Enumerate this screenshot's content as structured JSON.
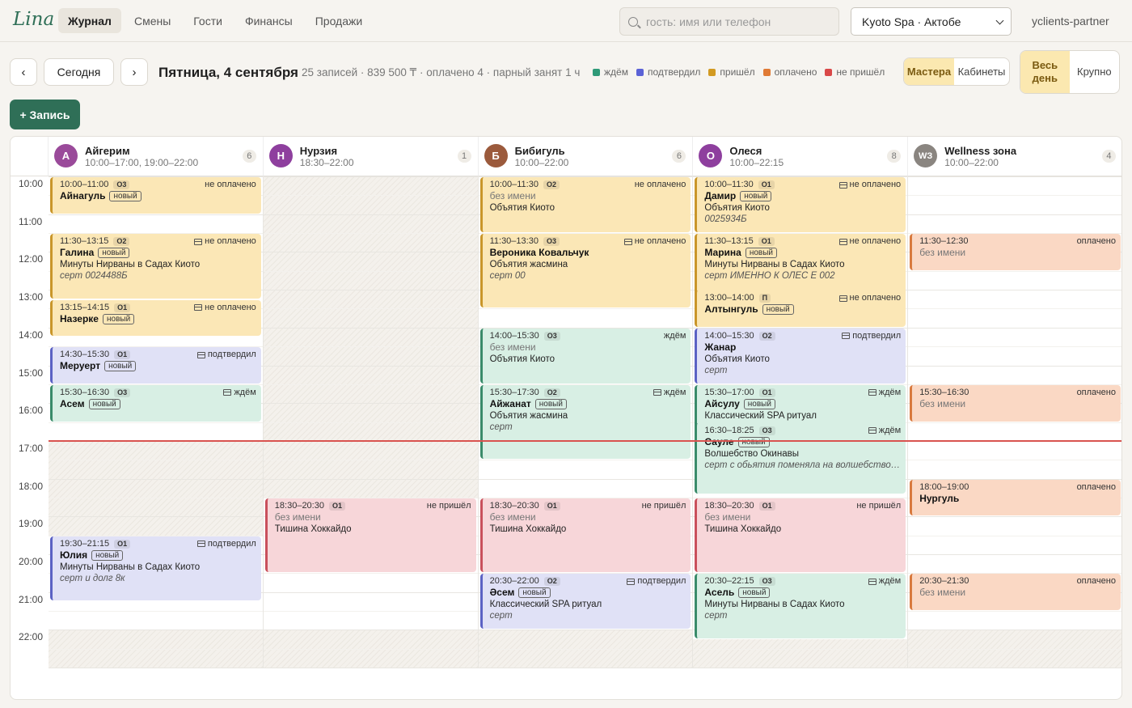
{
  "app": {
    "logo": "Lina",
    "user": "yclients-partner"
  },
  "nav": [
    "Журнал",
    "Смены",
    "Гости",
    "Финансы",
    "Продажи"
  ],
  "search": {
    "placeholder": "гость: имя или телефон"
  },
  "branch": "Kyoto Spa · Актобе",
  "toolbar": {
    "today": "Сегодня",
    "date": "Пятница, 4 сентября",
    "summary": "25 записей · 839 500 ₸ · оплачено 4 · парный занят 1 ч",
    "view_masters": "Мастера",
    "view_rooms": "Кабинеты",
    "range_day": "Весь день",
    "range_big": "Крупно",
    "add": "+ Запись"
  },
  "legend": [
    {
      "label": "ждём",
      "color": "#2f9a78"
    },
    {
      "label": "подтвердил",
      "color": "#5b62d6"
    },
    {
      "label": "пришёл",
      "color": "#d29a22"
    },
    {
      "label": "оплачено",
      "color": "#e07a35"
    },
    {
      "label": "не пришёл",
      "color": "#d94848"
    }
  ],
  "hours": [
    "10:00",
    "11:00",
    "12:00",
    "13:00",
    "14:00",
    "15:00",
    "16:00",
    "17:00",
    "18:00",
    "19:00",
    "20:00",
    "21:00",
    "22:00"
  ],
  "masters": [
    {
      "initial": "А",
      "name": "Айгерим",
      "hours": "10:00–17:00, 19:00–22:00",
      "count": "6",
      "color": "#9a4a9a"
    },
    {
      "initial": "Н",
      "name": "Нурзия",
      "hours": "18:30–22:00",
      "count": "1",
      "color": "#8e3f9e"
    },
    {
      "initial": "Б",
      "name": "Бибигуль",
      "hours": "10:00–22:00",
      "count": "6",
      "color": "#9b5a3c"
    },
    {
      "initial": "О",
      "name": "Олеся",
      "hours": "10:00–22:15",
      "count": "8",
      "color": "#8e3f9e"
    },
    {
      "initial": "WЗ",
      "name": "Wellness зона",
      "hours": "10:00–22:00",
      "count": "4",
      "color": "#8a8580"
    }
  ],
  "appointments": [
    {
      "col": 0,
      "start": "10:00",
      "end": "11:00",
      "time": "10:00–11:00",
      "room": "О3",
      "status": "не оплачено",
      "reg": false,
      "name": "Айнагуль",
      "new": true,
      "service": "",
      "note": "",
      "color": "y"
    },
    {
      "col": 0,
      "start": "11:30",
      "end": "13:15",
      "time": "11:30–13:15",
      "room": "О2",
      "status": "не оплачено",
      "reg": true,
      "name": "Галина",
      "new": true,
      "service": "Минуты Нирваны в Садах Киото",
      "note": "серт 0024488Б",
      "color": "y"
    },
    {
      "col": 0,
      "start": "13:15",
      "end": "14:15",
      "time": "13:15–14:15",
      "room": "О1",
      "status": "не оплачено",
      "reg": true,
      "name": "Назерке",
      "new": true,
      "service": "",
      "note": "",
      "color": "y"
    },
    {
      "col": 0,
      "start": "14:30",
      "end": "15:30",
      "time": "14:30–15:30",
      "room": "О1",
      "status": "подтвердил",
      "reg": true,
      "name": "Меруерт",
      "new": true,
      "service": "",
      "note": "",
      "color": "b"
    },
    {
      "col": 0,
      "start": "15:30",
      "end": "16:30",
      "time": "15:30–16:30",
      "room": "О3",
      "status": "ждём",
      "reg": true,
      "name": "Асем",
      "new": true,
      "service": "",
      "note": "",
      "color": "g"
    },
    {
      "col": 0,
      "start": "19:30",
      "end": "21:15",
      "time": "19:30–21:15",
      "room": "О1",
      "status": "подтвердил",
      "reg": true,
      "name": "Юлия",
      "new": true,
      "service": "Минуты Нирваны в Садах Киото",
      "note": "серт и долг 8к",
      "color": "b"
    },
    {
      "col": 1,
      "start": "18:30",
      "end": "20:30",
      "time": "18:30–20:30",
      "room": "О1",
      "status": "не пришёл",
      "reg": false,
      "name": "без имени",
      "noname": true,
      "new": false,
      "service": "Тишина Хоккайдо",
      "note": "",
      "color": "r"
    },
    {
      "col": 2,
      "start": "10:00",
      "end": "11:30",
      "time": "10:00–11:30",
      "room": "О2",
      "status": "не оплачено",
      "reg": false,
      "name": "без имени",
      "noname": true,
      "new": false,
      "service": "Объятия Киото",
      "note": "",
      "color": "y"
    },
    {
      "col": 2,
      "start": "11:30",
      "end": "13:30",
      "time": "11:30–13:30",
      "room": "О3",
      "status": "не оплачено",
      "reg": true,
      "name": "Вероника Ковальчук",
      "new": false,
      "service": "Объятия жасмина",
      "note": "серт 00",
      "color": "y"
    },
    {
      "col": 2,
      "start": "14:00",
      "end": "15:30",
      "time": "14:00–15:30",
      "room": "О3",
      "status": "ждём",
      "reg": false,
      "name": "без имени",
      "noname": true,
      "new": false,
      "service": "Объятия Киото",
      "note": "",
      "color": "g"
    },
    {
      "col": 2,
      "start": "15:30",
      "end": "17:30",
      "time": "15:30–17:30",
      "room": "О2",
      "status": "ждём",
      "reg": true,
      "name": "Айжанат",
      "new": true,
      "service": "Объятия жасмина",
      "note": "серт",
      "color": "g"
    },
    {
      "col": 2,
      "start": "18:30",
      "end": "20:30",
      "time": "18:30–20:30",
      "room": "О1",
      "status": "не пришёл",
      "reg": false,
      "name": "без имени",
      "noname": true,
      "new": false,
      "service": "Тишина Хоккайдо",
      "note": "",
      "color": "r"
    },
    {
      "col": 2,
      "start": "20:30",
      "end": "22:00",
      "time": "20:30–22:00",
      "room": "О2",
      "status": "подтвердил",
      "reg": true,
      "name": "Әсем",
      "new": true,
      "service": "Классический SPA ритуал",
      "note": "серт",
      "color": "b"
    },
    {
      "col": 3,
      "start": "10:00",
      "end": "11:30",
      "time": "10:00–11:30",
      "room": "О1",
      "status": "не оплачено",
      "reg": true,
      "name": "Дамир",
      "new": true,
      "service": "Объятия Киото",
      "note": "0025934Б",
      "color": "y"
    },
    {
      "col": 3,
      "start": "11:30",
      "end": "13:15",
      "time": "11:30–13:15",
      "room": "О1",
      "status": "не оплачено",
      "reg": true,
      "name": "Марина",
      "new": true,
      "service": "Минуты Нирваны в Садах Киото",
      "note": "серт ИМЕННО К ОЛЕС Е 002",
      "color": "y"
    },
    {
      "col": 3,
      "start": "13:00",
      "end": "14:00",
      "time": "13:00–14:00",
      "room": "П",
      "status": "не оплачено",
      "reg": true,
      "name": "Алтынгуль",
      "new": true,
      "service": "",
      "note": "",
      "color": "y"
    },
    {
      "col": 3,
      "start": "14:00",
      "end": "15:30",
      "time": "14:00–15:30",
      "room": "О2",
      "status": "подтвердил",
      "reg": true,
      "name": "Жанар",
      "new": false,
      "service": "Объятия Киото",
      "note": "серт",
      "color": "b"
    },
    {
      "col": 3,
      "start": "15:30",
      "end": "17:00",
      "time": "15:30–17:00",
      "room": "О1",
      "status": "ждём",
      "reg": true,
      "name": "Айсулу",
      "new": true,
      "service": "Классический SPA ритуал",
      "note": "",
      "color": "g"
    },
    {
      "col": 3,
      "start": "16:30",
      "end": "18:25",
      "time": "16:30–18:25",
      "room": "О3",
      "status": "ждём",
      "reg": true,
      "name": "Сауле",
      "new": true,
      "service": "Волшебство Окинавы",
      "note": "серт с обьятия поменяла на волшебство имени",
      "color": "g"
    },
    {
      "col": 3,
      "start": "18:30",
      "end": "20:30",
      "time": "18:30–20:30",
      "room": "О1",
      "status": "не пришёл",
      "reg": false,
      "name": "без имени",
      "noname": true,
      "new": false,
      "service": "Тишина Хоккайдо",
      "note": "",
      "color": "r"
    },
    {
      "col": 3,
      "start": "20:30",
      "end": "22:15",
      "time": "20:30–22:15",
      "room": "О3",
      "status": "ждём",
      "reg": true,
      "name": "Асель",
      "new": true,
      "service": "Минуты Нирваны в Садах Киото",
      "note": "серт",
      "color": "g"
    },
    {
      "col": 4,
      "start": "11:30",
      "end": "12:30",
      "time": "11:30–12:30",
      "room": "",
      "status": "оплачено",
      "reg": false,
      "name": "без имени",
      "noname": true,
      "new": false,
      "service": "",
      "note": "",
      "color": "o"
    },
    {
      "col": 4,
      "start": "15:30",
      "end": "16:30",
      "time": "15:30–16:30",
      "room": "",
      "status": "оплачено",
      "reg": false,
      "name": "без имени",
      "noname": true,
      "new": false,
      "service": "",
      "note": "",
      "color": "o"
    },
    {
      "col": 4,
      "start": "18:00",
      "end": "19:00",
      "time": "18:00–19:00",
      "room": "",
      "status": "оплачено",
      "reg": false,
      "name": "Нургуль",
      "new": false,
      "service": "",
      "note": "",
      "color": "o"
    },
    {
      "col": 4,
      "start": "20:30",
      "end": "21:30",
      "time": "20:30–21:30",
      "room": "",
      "status": "оплачено",
      "reg": false,
      "name": "без имени",
      "noname": true,
      "new": false,
      "service": "",
      "note": "",
      "color": "o"
    }
  ],
  "labels": {
    "new": "новый"
  },
  "current_time": "17:00"
}
